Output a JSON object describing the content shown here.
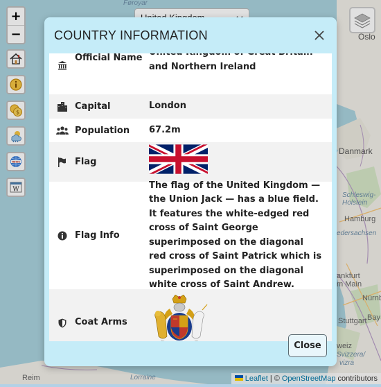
{
  "map": {
    "labels": {
      "faroe": "Føroyar",
      "oslo": "Oslo",
      "danmark": "Danmark",
      "hamburg": "Hamburg",
      "schleswig": "Schleswig-Holstein",
      "niedersachsen": "edersachsen",
      "frankfurt": "ankfurt",
      "main": "m Main",
      "nurnberg": "Nürnb",
      "stuttgart": "Stuttgart",
      "bayern": "Bay",
      "schweiz": "weiz",
      "svizzera": "Svizzera/",
      "svizra": "vizra",
      "lorraine": "Lorraine",
      "reim": "Reim"
    }
  },
  "controls": {
    "zoom_in": "+",
    "zoom_out": "−",
    "country_select": "United Kingdom",
    "side_buttons": [
      "home-icon",
      "info-icon",
      "coins-icon",
      "weather-icon",
      "news-icon",
      "wikipedia-icon"
    ]
  },
  "modal": {
    "title": "COUNTRY INFORMATION",
    "close_label": "Close",
    "rows": [
      {
        "label": "Official Name",
        "value": "United Kingdom of Great Britain and Northern Ireland",
        "icon": "landmark-icon"
      },
      {
        "label": "Capital",
        "value": "London",
        "icon": "city-icon"
      },
      {
        "label": "Population",
        "value": "67.2m",
        "icon": "people-icon"
      },
      {
        "label": "Flag",
        "value": "",
        "icon": "flag-icon"
      },
      {
        "label": "Flag Info",
        "value": "The flag of the United Kingdom — the Union Jack — has a blue field. It features the white-edged red cross of Saint George superimposed on the diagonal red cross of Saint Patrick which is superimposed on the diagonal white cross of Saint Andrew.",
        "icon": "info-circle-icon"
      },
      {
        "label": "Coat Arms",
        "value": "",
        "icon": "shield-icon"
      }
    ]
  },
  "attribution": {
    "leaflet": "Leaflet",
    "separator": "| ©",
    "osm": "OpenStreetMap",
    "contributors": "contributors"
  },
  "colors": {
    "modal_bg": "#c5ecf8",
    "row_alt": "#f2f2f2",
    "sea": "#b3d1e6",
    "land": "#f2efe9"
  }
}
